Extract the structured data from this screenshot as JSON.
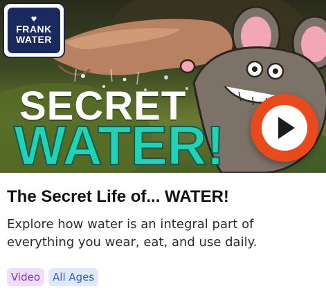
{
  "thumbnail": {
    "logo_lines": [
      "FRANK",
      "WATER"
    ],
    "headline_line1": "SECRET",
    "headline_line2": "WATER!",
    "play_icon": "play-icon",
    "colors": {
      "logo_bg": "#1b2a5e",
      "headline_accent": "#20d3b4",
      "play_button": "#e94a1d",
      "mascot_body": "#7d7268"
    }
  },
  "card": {
    "title": "The Secret Life of... WATER!",
    "description": "Explore how water is an integral part of everything you wear, eat, and use daily.",
    "tags": [
      "Video",
      "All Ages"
    ],
    "tag_colors": {
      "video_bg": "#f0ddfb",
      "video_text": "#7d3bb0",
      "ages_bg": "#dfe9fb",
      "ages_text": "#2b63bf"
    }
  }
}
